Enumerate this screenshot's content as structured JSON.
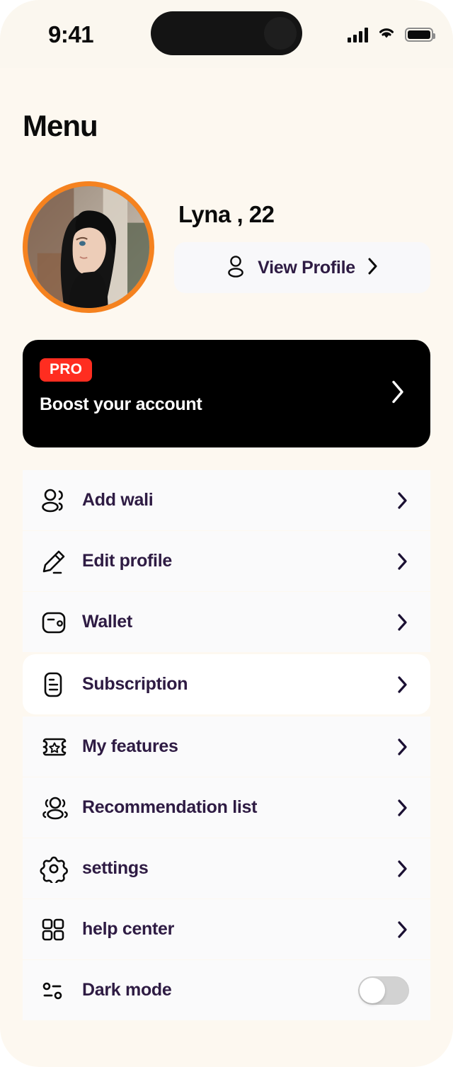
{
  "statusbar": {
    "time": "9:41",
    "signal_icon": "signal-bars-icon",
    "wifi_icon": "wifi-icon",
    "battery_icon": "battery-full-icon"
  },
  "header": {
    "title": "Menu"
  },
  "profile": {
    "name": "Lyna , 22",
    "avatar_alt": "user-avatar",
    "ring_color": "#F5821F",
    "view_profile": {
      "label": "View Profile",
      "icon": "person-icon",
      "chevron": "chevron-right-icon"
    }
  },
  "promo": {
    "badge": "PRO",
    "title": "Boost your account",
    "badge_color": "#FF2D20",
    "background_color": "#000000",
    "chevron": "chevron-right-icon"
  },
  "menu": {
    "items": [
      {
        "label": "Add wali",
        "icon": "people-add-icon",
        "trailing": "chevron-right-icon",
        "highlighted": false
      },
      {
        "label": "Edit profile",
        "icon": "pencil-edit-icon",
        "trailing": "chevron-right-icon",
        "highlighted": false
      },
      {
        "label": "Wallet",
        "icon": "wallet-icon",
        "trailing": "chevron-right-icon",
        "highlighted": false
      },
      {
        "label": "Subscription",
        "icon": "document-lines-icon",
        "trailing": "chevron-right-icon",
        "highlighted": true
      },
      {
        "label": "My features",
        "icon": "ticket-star-icon",
        "trailing": "chevron-right-icon",
        "highlighted": false
      },
      {
        "label": "Recommendation list",
        "icon": "group-people-icon",
        "trailing": "chevron-right-icon",
        "highlighted": false
      },
      {
        "label": "settings",
        "icon": "gear-icon",
        "trailing": "chevron-right-icon",
        "highlighted": false
      },
      {
        "label": "help center",
        "icon": "grid-squares-icon",
        "trailing": "chevron-right-icon",
        "highlighted": false
      },
      {
        "label": "Dark mode",
        "icon": "sliders-icon",
        "trailing": "toggle-switch",
        "highlighted": false,
        "toggle_on": false
      }
    ]
  },
  "colors": {
    "page_background": "#FDF8F0",
    "row_background": "#FAFAFB",
    "text_primary": "#2E1B43",
    "accent_orange": "#F5821F",
    "accent_red": "#FF2D20"
  }
}
